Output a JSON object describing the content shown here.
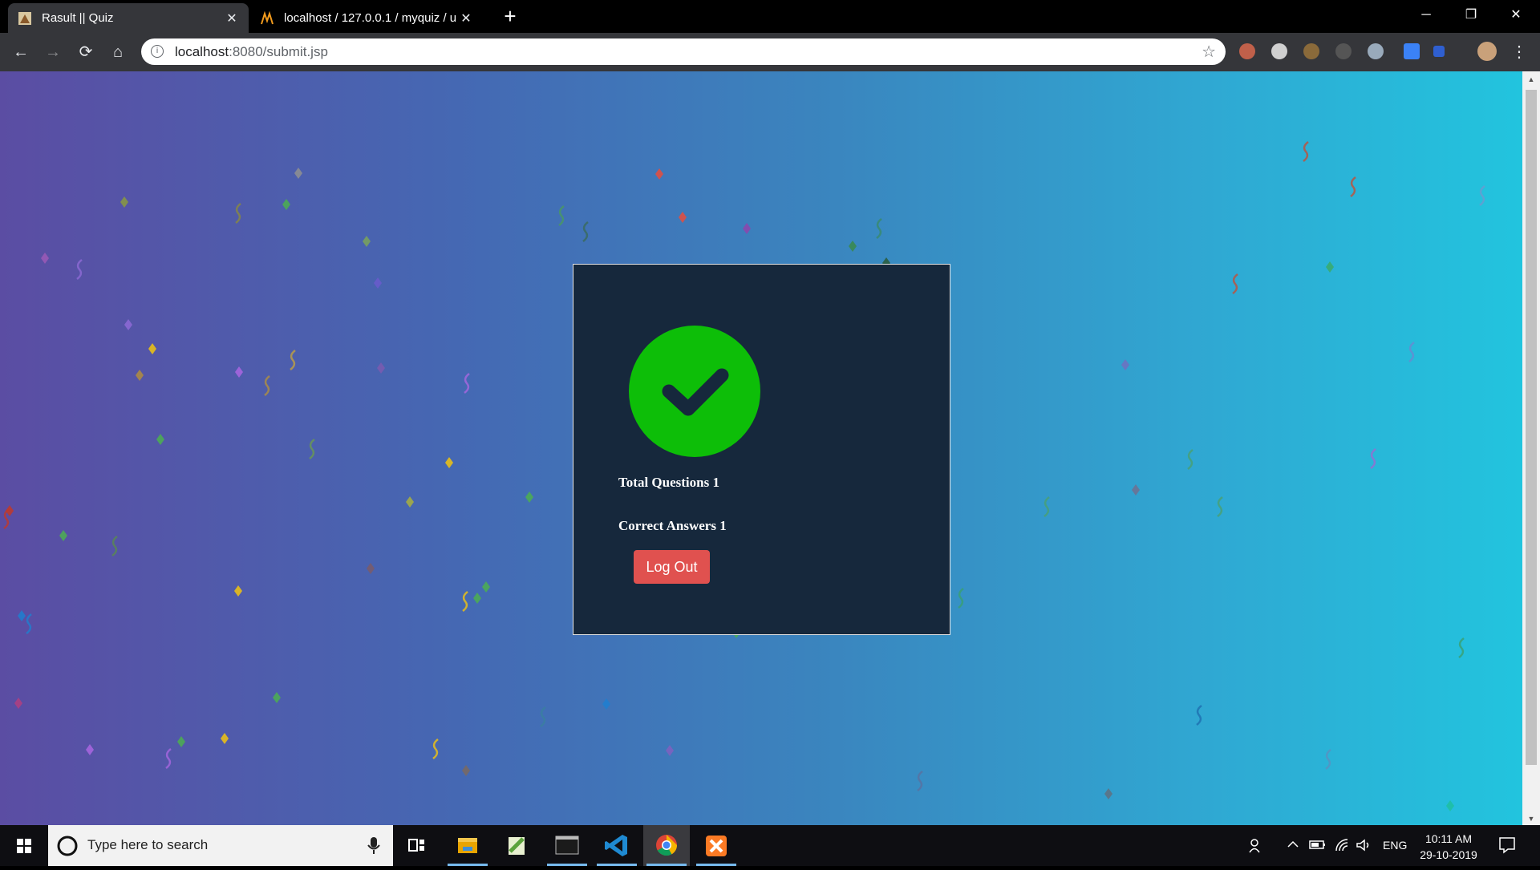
{
  "browser": {
    "tabs": [
      {
        "title": "Rasult || Quiz",
        "active": true
      },
      {
        "title": "localhost / 127.0.0.1 / myquiz / u",
        "active": false
      }
    ],
    "new_tab": "+",
    "close_glyph": "✕",
    "window_controls": {
      "minimize": "─",
      "restore": "❐",
      "close": "✕"
    },
    "nav": {
      "back": "←",
      "forward": "→",
      "reload": "⟳",
      "home": "⌂"
    },
    "url": {
      "host": "localhost",
      "rest": ":8080/submit.jsp"
    },
    "bookmark_star": "☆",
    "menu": "⋮"
  },
  "result": {
    "total_questions_label": "Total Questions 1",
    "correct_answers_label": "Correct Answers 1",
    "logout_label": "Log Out"
  },
  "taskbar": {
    "search_placeholder": "Type here to search",
    "language": "ENG",
    "time": "10:11 AM",
    "date": "29-10-2019"
  },
  "colors": {
    "gradient_left": "#5b4da3",
    "gradient_right": "#22c4de",
    "card": "#16283c",
    "check_circle": "#0dbe08",
    "logout_button": "#e0514f"
  }
}
